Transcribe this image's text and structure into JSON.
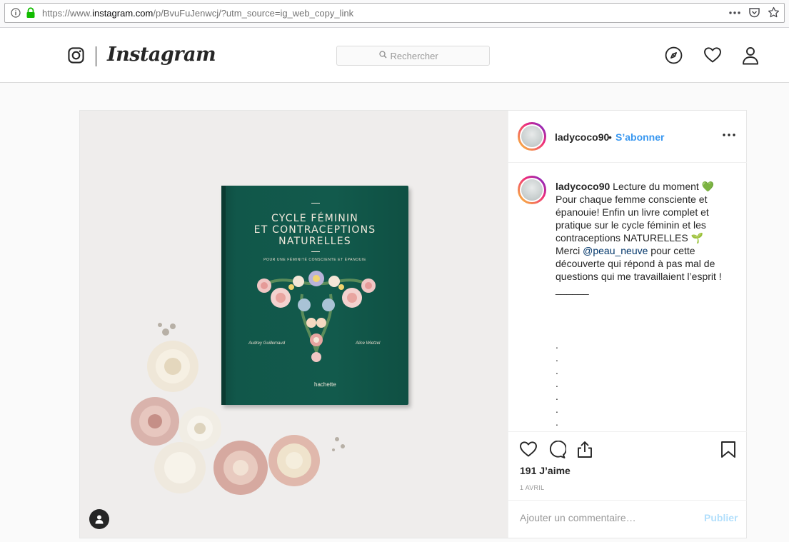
{
  "browser": {
    "url_prefix": "https://www.",
    "url_host": "instagram.com",
    "url_rest": "/p/BvuFuJenwcj/?utm_source=ig_web_copy_link",
    "icons": [
      "info-icon",
      "lock-icon",
      "more-dots-icon",
      "pocket-icon",
      "bookmark-star-icon"
    ]
  },
  "header": {
    "wordmark": "Instagram",
    "search_placeholder": "Rechercher",
    "nav_icons": [
      "compass-icon",
      "heart-icon",
      "profile-icon"
    ]
  },
  "post": {
    "username": "ladycoco90",
    "separator": "•",
    "follow_label": "S’abonner",
    "book": {
      "title_line1": "CYCLE FÉMININ",
      "title_line2": "ET CONTRACEPTIONS",
      "title_line3": "NATURELLES",
      "subtitle": "POUR UNE FÉMINITÉ CONSCIENTE ET ÉPANOUIE",
      "credit_left": "Audrey Guillemaud",
      "credit_right": "Alice Wietzel",
      "publisher": "hachette"
    },
    "caption": {
      "username": "ladycoco90",
      "line1": " Lecture du moment 💚",
      "body": "Pour chaque femme consciente et épanouie! Enfin un livre complet et pratique sur le cycle féminin et les contraceptions NATURELLES 🌱",
      "thanks_prefix": "Merci ",
      "mention": "@peau_neuve",
      "thanks_suffix": " pour cette découverte qui répond à pas mal de questions qui me travaillaient l’esprit !",
      "rule": "______",
      "dots": [
        ".",
        ".",
        ".",
        ".",
        ".",
        ".",
        ".",
        ".",
        ".",
        "."
      ]
    },
    "likes": "191 J’aime",
    "date": "1 AVRIL",
    "comment_placeholder": "Ajouter un commentaire…",
    "publish_label": "Publier"
  },
  "colors": {
    "link_blue": "#3897f0",
    "publish_disabled": "#b2dffc",
    "book_green": "#125a4c",
    "secure_green": "#12bc00"
  }
}
